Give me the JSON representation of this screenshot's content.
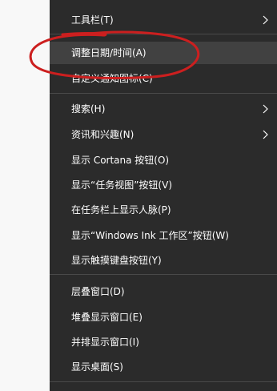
{
  "menu": {
    "items": [
      {
        "label": "工具栏(T)"
      },
      {
        "label": "调整日期/时间(A)"
      },
      {
        "label": "自定义通知图标(C)"
      },
      {
        "label": "搜索(H)"
      },
      {
        "label": "资讯和兴趣(N)"
      },
      {
        "label": "显示 Cortana 按钮(O)"
      },
      {
        "label": "显示“任务视图”按钮(V)"
      },
      {
        "label": "在任务栏上显示人脉(P)"
      },
      {
        "label": "显示“Windows Ink 工作区”按钮(W)"
      },
      {
        "label": "显示触摸键盘按钮(Y)"
      },
      {
        "label": "层叠窗口(D)"
      },
      {
        "label": "堆叠显示窗口(E)"
      },
      {
        "label": "并排显示窗口(I)"
      },
      {
        "label": "显示桌面(S)"
      }
    ]
  },
  "colors": {
    "menu_background": "#2b2b2b",
    "menu_text": "#ffffff",
    "hover_background": "#414141",
    "separator": "#4a4a4a",
    "annotation": "#cc1f1f"
  },
  "icons": {
    "submenu_arrow": "chevron-right-icon"
  }
}
